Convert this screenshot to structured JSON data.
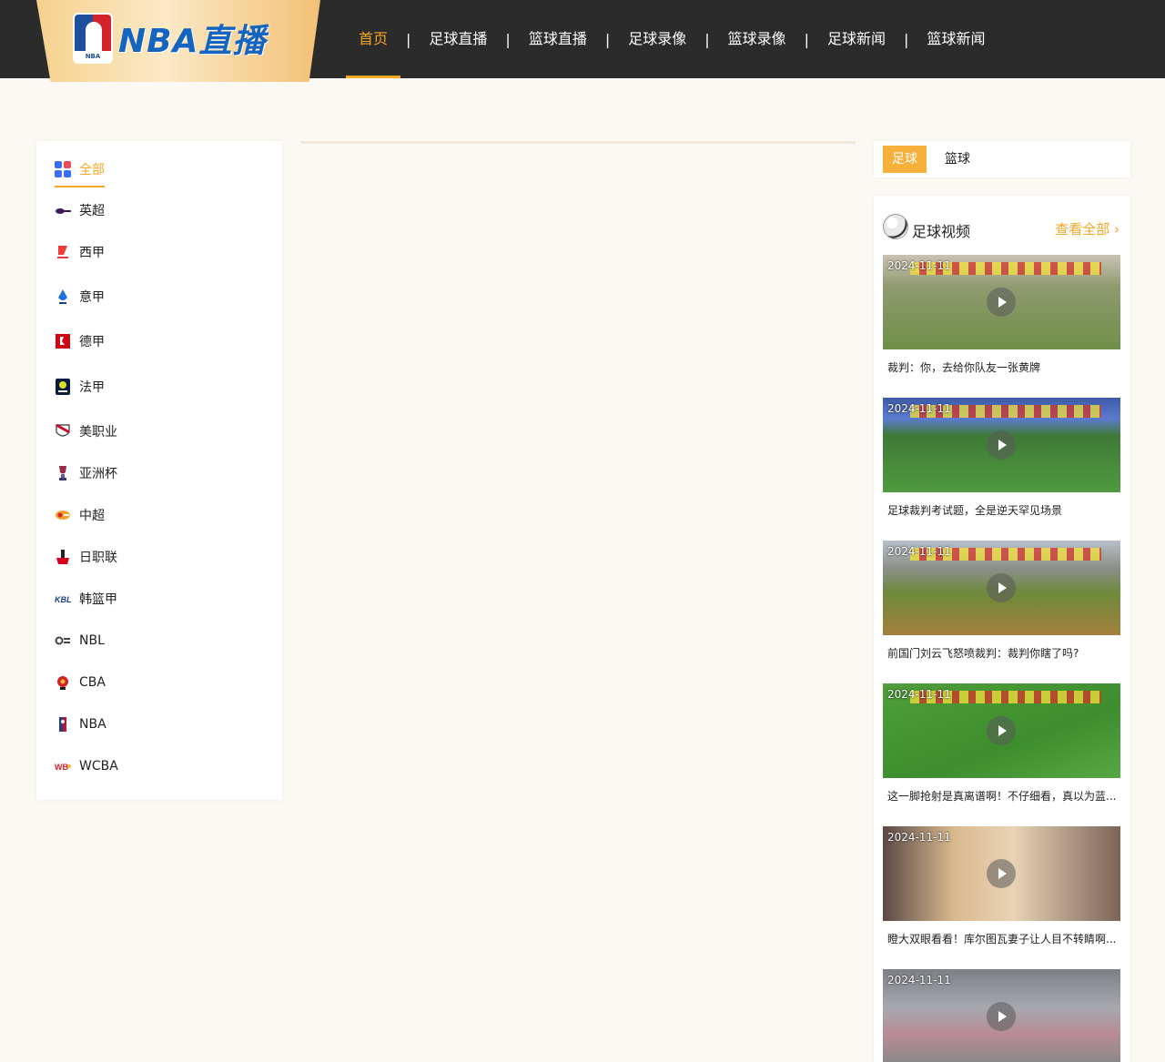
{
  "header": {
    "logo_text": "NBA直播",
    "logo_badge": "NBA",
    "nav": [
      {
        "label": "首页",
        "active": true
      },
      {
        "label": "足球直播"
      },
      {
        "label": "篮球直播"
      },
      {
        "label": "足球录像"
      },
      {
        "label": "篮球录像"
      },
      {
        "label": "足球新闻"
      },
      {
        "label": "篮球新闻"
      }
    ],
    "separator": "|"
  },
  "sidebar": {
    "items": [
      {
        "label": "全部",
        "icon": "grid-icon",
        "active": true
      },
      {
        "label": "英超",
        "icon": "premier-league-icon"
      },
      {
        "label": "西甲",
        "icon": "laliga-icon"
      },
      {
        "label": "意甲",
        "icon": "serie-a-icon"
      },
      {
        "label": "德甲",
        "icon": "bundesliga-icon"
      },
      {
        "label": "法甲",
        "icon": "ligue-1-icon"
      },
      {
        "label": "美职业",
        "icon": "mls-icon"
      },
      {
        "label": "亚洲杯",
        "icon": "asian-cup-icon"
      },
      {
        "label": "中超",
        "icon": "csl-icon"
      },
      {
        "label": "日职联",
        "icon": "j-league-icon"
      },
      {
        "label": "韩篮甲",
        "icon": "kbl-icon"
      },
      {
        "label": "NBL",
        "icon": "nbl-icon"
      },
      {
        "label": "CBA",
        "icon": "cba-icon"
      },
      {
        "label": "NBA",
        "icon": "nba-icon"
      },
      {
        "label": "WCBA",
        "icon": "wcba-icon"
      }
    ]
  },
  "right": {
    "tabs": [
      {
        "label": "足球",
        "active": true
      },
      {
        "label": "篮球"
      }
    ],
    "videos_title": "足球视频",
    "more_label": "查看全部",
    "more_arrow": "›",
    "videos": [
      {
        "date": "2024-11-11",
        "title": "裁判：你，去给你队友一张黄牌"
      },
      {
        "date": "2024-11-11",
        "title": "足球裁判考试题，全是逆天罕见场景"
      },
      {
        "date": "2024-11-11",
        "title": "前国门刘云飞怒喷裁判：裁判你瞎了吗?"
      },
      {
        "date": "2024-11-11",
        "title": "这一脚抢射是真离谱啊！不仔细看，真以为蓝..."
      },
      {
        "date": "2024-11-11",
        "title": "瞪大双眼看看！库尔图瓦妻子让人目不转睛啊..."
      },
      {
        "date": "2024-11-11",
        "title": ""
      }
    ]
  },
  "colors": {
    "accent": "#f5a623",
    "header_bg": "#2b2b2b",
    "page_bg": "#fcf9f5"
  }
}
